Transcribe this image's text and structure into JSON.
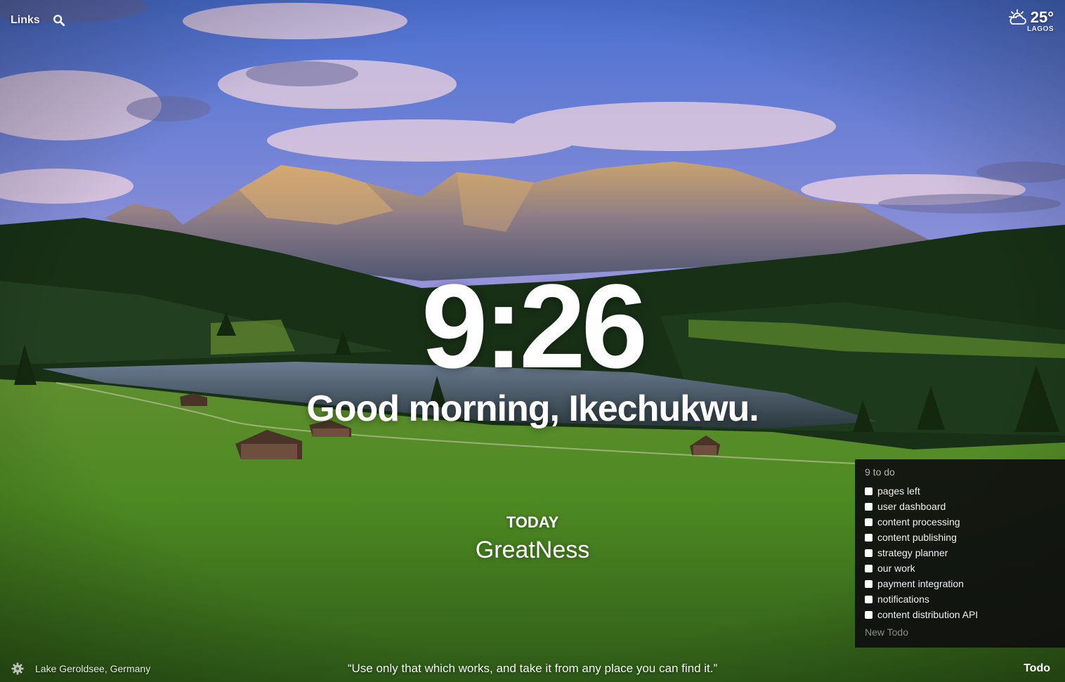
{
  "top_nav": {
    "links_label": "Links",
    "search_icon": "search-icon"
  },
  "weather": {
    "icon": "partly-cloudy-icon",
    "temperature": "25°",
    "location": "LAGOS"
  },
  "clock": {
    "time": "9:26"
  },
  "greeting": {
    "text": "Good morning, Ikechukwu."
  },
  "focus": {
    "label": "TODAY",
    "value": "GreatNess"
  },
  "todo": {
    "count_label": "9 to do",
    "items": [
      {
        "label": "pages left",
        "done": false
      },
      {
        "label": "user dashboard",
        "done": false
      },
      {
        "label": "content processing",
        "done": false
      },
      {
        "label": "content publishing",
        "done": false
      },
      {
        "label": "strategy planner",
        "done": false
      },
      {
        "label": "our work",
        "done": false
      },
      {
        "label": "payment integration",
        "done": false
      },
      {
        "label": "notifications",
        "done": false
      },
      {
        "label": "content distribution API",
        "done": false
      }
    ],
    "new_placeholder": "New Todo",
    "toggle_label": "Todo"
  },
  "footer": {
    "settings_icon": "gear-icon",
    "photo_location": "Lake Geroldsee, Germany",
    "quote": "“Use only that which works, and take it from any place you can find it.”"
  },
  "colors": {
    "panel_bg": "#0f0f0f",
    "text": "#ffffff",
    "muted": "#b5b5b5"
  }
}
